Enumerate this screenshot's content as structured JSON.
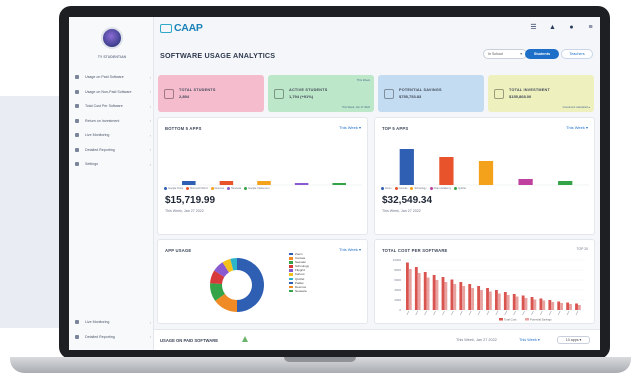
{
  "sidebar": {
    "user_name": "TY STUDENTIAN",
    "items": [
      {
        "label": "Usage on Paid Software"
      },
      {
        "label": "Usage on Non-Paid Software"
      },
      {
        "label": "Total Cost Per Software"
      },
      {
        "label": "Return on Investment"
      },
      {
        "label": "Live Monitoring"
      },
      {
        "label": "Detailed Reporting"
      },
      {
        "label": "Settings"
      }
    ],
    "bottom_items": [
      {
        "label": "Live Monitoring"
      },
      {
        "label": "Detailed Reporting"
      }
    ]
  },
  "header": {
    "logo_text": "CAAP",
    "page_title": "SOFTWARE USAGE ANALYTICS",
    "filter_value": "In School",
    "toggle_active": "Students",
    "toggle_inactive": "Teachers"
  },
  "kpis": [
    {
      "title": "TOTAL STUDENTS",
      "value": "2,894",
      "color": "#f4bccd",
      "note": "",
      "sub": ""
    },
    {
      "title": "ACTIVE STUDENTS",
      "value": "1,794 (+91%)",
      "color": "#bde7c9",
      "note": "This Week",
      "sub": "This Week, Jan 27 2022"
    },
    {
      "title": "POTENTIAL SAVINGS",
      "value": "$755,753.83",
      "color": "#c3dcf1",
      "note": "",
      "sub": ""
    },
    {
      "title": "TOTAL INVESTMENT",
      "value": "$155,868.00",
      "color": "#eef0be",
      "note": "",
      "sub": "Investment calculated ●"
    }
  ],
  "bottom5": {
    "title": "BOTTOM 5 APPS",
    "period": "This Week ▾",
    "amount": "$15,719.99",
    "date": "This Week, Jan 27 2022",
    "legend": [
      "Google Drive",
      "Microsoft Word",
      "Desmos",
      "Newsela",
      "Google Classroom"
    ]
  },
  "top5": {
    "title": "TOP 5 APPS",
    "period": "This Week ▾",
    "amount": "$32,549.34",
    "date": "This Week, Jan 27 2022",
    "legend": [
      "Zoom",
      "Canvas",
      "Schoology",
      "Khan Academy",
      "Quizlet"
    ]
  },
  "app_usage": {
    "title": "APP USAGE",
    "period": "This Week ▾",
    "legend": [
      "Zoom",
      "Canvas",
      "Seesaw",
      "Schoology",
      "Flipgrid",
      "Kahoot",
      "Quizlet",
      "Padlet",
      "Desmos",
      "Newsela"
    ]
  },
  "cost": {
    "title": "TOTAL COST PER SOFTWARE",
    "top_label": "TOP 20"
  },
  "bottom_bar": {
    "title": "USAGE ON PAID SOFTWARE",
    "date": "This Week, Jan 27 2022",
    "period": "This Week ▾",
    "apps": "10 apps ▾"
  },
  "colors": {
    "accent": "#1d6fc7",
    "donut": [
      "#2f5fb3",
      "#f08a24",
      "#35a347",
      "#d63a3a",
      "#8a5bd0",
      "#f4c21b",
      "#2cb5c9"
    ],
    "bottom_bars": [
      "#2f5fb3",
      "#e8532b",
      "#f4a11b",
      "#8a5bd0",
      "#35a347"
    ],
    "top_bars": [
      "#2f5fb3",
      "#e8532b",
      "#f4a11b",
      "#c040a0",
      "#35a347"
    ]
  },
  "chart_data": [
    {
      "type": "bar",
      "title": "BOTTOM 5 APPS",
      "categories": [
        "Google Drive",
        "Microsoft Word",
        "Desmos",
        "Newsela",
        "Google Classroom"
      ],
      "values": [
        2,
        2,
        2,
        1,
        1
      ]
    },
    {
      "type": "bar",
      "title": "TOP 5 APPS",
      "categories": [
        "Zoom",
        "Canvas",
        "Schoology",
        "Khan Academy",
        "Quizlet"
      ],
      "values": [
        18,
        14,
        12,
        3,
        2
      ]
    },
    {
      "type": "pie",
      "title": "APP USAGE",
      "categories": [
        "Zoom",
        "Canvas",
        "Seesaw",
        "Schoology",
        "Flipgrid",
        "Kahoot",
        "Quizlet"
      ],
      "values": [
        50,
        15,
        11,
        8,
        7,
        5,
        4
      ]
    },
    {
      "type": "bar",
      "title": "TOTAL COST PER SOFTWARE",
      "series": [
        {
          "name": "Total Cost",
          "values": [
            9500,
            8600,
            7600,
            7000,
            6600,
            6100,
            5600,
            5200,
            4800,
            4400,
            4000,
            3600,
            3200,
            2900,
            2600,
            2300,
            2000,
            1700,
            1500,
            1300
          ]
        },
        {
          "name": "Potential Savings",
          "values": [
            8200,
            7400,
            6500,
            6000,
            5600,
            5200,
            4800,
            4400,
            4000,
            3700,
            3300,
            3000,
            2700,
            2400,
            2100,
            1900,
            1600,
            1400,
            1200,
            1000
          ]
        }
      ],
      "ylim": [
        0,
        10000
      ],
      "yticks": [
        "10000",
        "8000",
        "6000",
        "4000",
        "2000",
        "0"
      ]
    }
  ]
}
